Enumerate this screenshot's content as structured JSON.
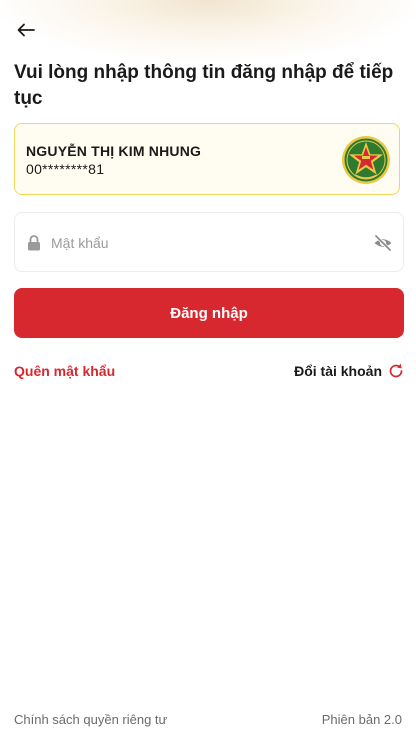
{
  "header": {
    "back_icon": "arrow-left-icon"
  },
  "title": "Vui lòng nhập thông tin đăng nhập để tiếp tục",
  "account": {
    "name": "NGUYỄN THỊ KIM NHUNG",
    "phone": "00********81",
    "avatar_icon": "police-emblem-icon"
  },
  "password": {
    "placeholder": "Mật khẩu",
    "value": "",
    "lock_icon": "lock-icon",
    "toggle_icon": "eye-off-icon"
  },
  "actions": {
    "login_label": "Đăng nhập",
    "forgot_password_label": "Quên mật khẩu",
    "switch_account_label": "Đổi tài khoản",
    "switch_account_icon": "refresh-icon"
  },
  "footer": {
    "privacy_label": "Chính sách quyền riêng tư",
    "version_label": "Phiên bản 2.0"
  },
  "colors": {
    "primary": "#d7282f",
    "card_border": "#f2d75a",
    "text": "#1a1a1a",
    "muted": "#6b6b6b"
  }
}
